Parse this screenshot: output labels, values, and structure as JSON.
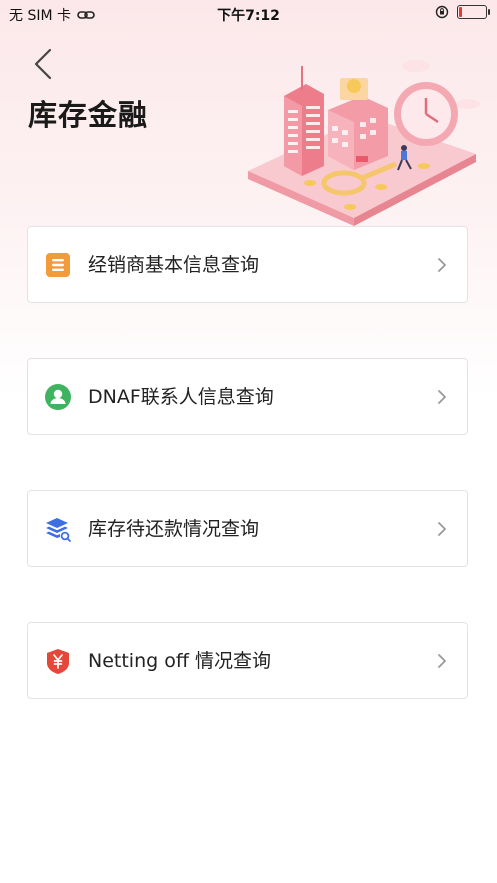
{
  "status_bar": {
    "carrier": "无 SIM 卡",
    "time": "下午7:12"
  },
  "header": {
    "title": "库存金融"
  },
  "menu": [
    {
      "label": "经销商基本信息查询",
      "icon": "document-list-icon",
      "icon_color": "#f39b3b"
    },
    {
      "label": "DNAF联系人信息查询",
      "icon": "contact-person-icon",
      "icon_color": "#3fb35f"
    },
    {
      "label": "库存待还款情况查询",
      "icon": "stack-search-icon",
      "icon_color": "#3d6fe0"
    },
    {
      "label": "Netting off 情况查询",
      "icon": "yuan-shield-icon",
      "icon_color": "#e5473b"
    }
  ]
}
